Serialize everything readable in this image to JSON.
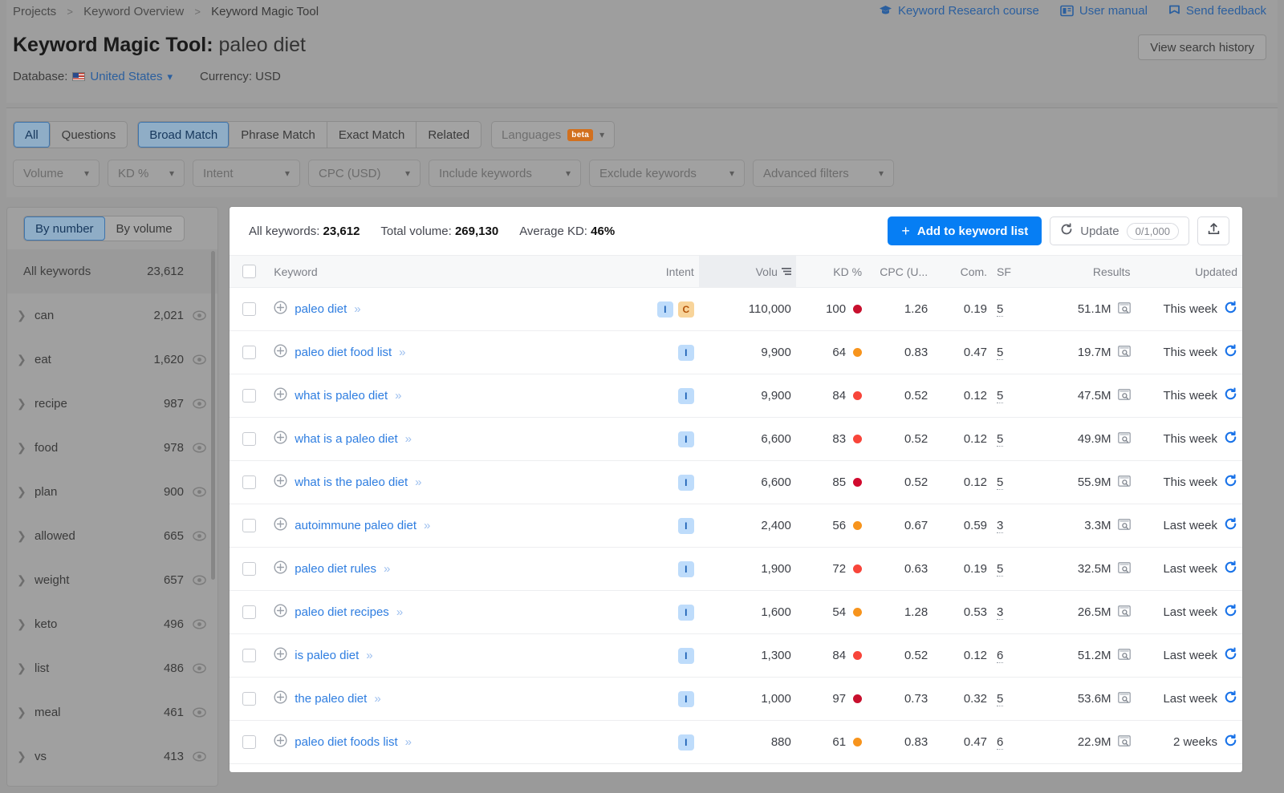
{
  "breadcrumb": {
    "items": [
      "Projects",
      "Keyword Overview",
      "Keyword Magic Tool"
    ],
    "separator": ">"
  },
  "header": {
    "title_prefix": "Keyword Magic Tool:",
    "query": "paleo diet",
    "view_search_history": "View search history",
    "links": [
      {
        "label": "Keyword Research course",
        "icon": "graduation-cap-icon"
      },
      {
        "label": "User manual",
        "icon": "book-icon"
      },
      {
        "label": "Send feedback",
        "icon": "flag-icon"
      }
    ],
    "database_label": "Database:",
    "database_value": "United States",
    "currency_label": "Currency: USD"
  },
  "filters": {
    "match_tabs_group1": [
      {
        "label": "All",
        "selected": true
      },
      {
        "label": "Questions",
        "selected": false
      }
    ],
    "match_tabs_group2": [
      {
        "label": "Broad Match",
        "selected": true
      },
      {
        "label": "Phrase Match",
        "selected": false
      },
      {
        "label": "Exact Match",
        "selected": false
      },
      {
        "label": "Related",
        "selected": false
      }
    ],
    "languages": {
      "label": "Languages",
      "badge": "beta"
    },
    "dropdowns": [
      "Volume",
      "KD %",
      "Intent",
      "CPC (USD)",
      "Include keywords",
      "Exclude keywords",
      "Advanced filters"
    ]
  },
  "sidebar": {
    "toggle": [
      {
        "label": "By number",
        "selected": true
      },
      {
        "label": "By volume",
        "selected": false
      }
    ],
    "all_keywords_label": "All keywords",
    "all_keywords_count": "23,612",
    "groups": [
      {
        "label": "can",
        "count": "2,021"
      },
      {
        "label": "eat",
        "count": "1,620"
      },
      {
        "label": "recipe",
        "count": "987"
      },
      {
        "label": "food",
        "count": "978"
      },
      {
        "label": "plan",
        "count": "900"
      },
      {
        "label": "allowed",
        "count": "665"
      },
      {
        "label": "weight",
        "count": "657"
      },
      {
        "label": "keto",
        "count": "496"
      },
      {
        "label": "list",
        "count": "486"
      },
      {
        "label": "meal",
        "count": "461"
      },
      {
        "label": "vs",
        "count": "413"
      }
    ]
  },
  "main": {
    "summary": {
      "all_keywords_label": "All keywords:",
      "all_keywords_value": "23,612",
      "total_volume_label": "Total volume:",
      "total_volume_value": "269,130",
      "average_kd_label": "Average KD:",
      "average_kd_value": "46%"
    },
    "actions": {
      "add_to_list": "Add to keyword list",
      "update": "Update",
      "update_count": "0/1,000",
      "export_icon": "upload-icon"
    },
    "columns": {
      "keyword": "Keyword",
      "intent": "Intent",
      "volume": "Volu",
      "kd": "KD %",
      "cpc": "CPC (U...",
      "com": "Com.",
      "sf": "SF",
      "results": "Results",
      "updated": "Updated"
    },
    "rows": [
      {
        "keyword": "paleo diet",
        "intents": [
          "I",
          "C"
        ],
        "volume": "110,000",
        "kd": "100",
        "kd_color": "#c8102e",
        "cpc": "1.26",
        "com": "0.19",
        "sf": "5",
        "results": "51.1M",
        "updated": "This week"
      },
      {
        "keyword": "paleo diet food list",
        "intents": [
          "I"
        ],
        "volume": "9,900",
        "kd": "64",
        "kd_color": "#f7941d",
        "cpc": "0.83",
        "com": "0.47",
        "sf": "5",
        "results": "19.7M",
        "updated": "This week"
      },
      {
        "keyword": "what is paleo diet",
        "intents": [
          "I"
        ],
        "volume": "9,900",
        "kd": "84",
        "kd_color": "#f8453a",
        "cpc": "0.52",
        "com": "0.12",
        "sf": "5",
        "results": "47.5M",
        "updated": "This week"
      },
      {
        "keyword": "what is a paleo diet",
        "intents": [
          "I"
        ],
        "volume": "6,600",
        "kd": "83",
        "kd_color": "#f8453a",
        "cpc": "0.52",
        "com": "0.12",
        "sf": "5",
        "results": "49.9M",
        "updated": "This week"
      },
      {
        "keyword": "what is the paleo diet",
        "intents": [
          "I"
        ],
        "volume": "6,600",
        "kd": "85",
        "kd_color": "#d10a2e",
        "cpc": "0.52",
        "com": "0.12",
        "sf": "5",
        "results": "55.9M",
        "updated": "This week"
      },
      {
        "keyword": "autoimmune paleo diet",
        "intents": [
          "I"
        ],
        "volume": "2,400",
        "kd": "56",
        "kd_color": "#f7941d",
        "cpc": "0.67",
        "com": "0.59",
        "sf": "3",
        "results": "3.3M",
        "updated": "Last week"
      },
      {
        "keyword": "paleo diet rules",
        "intents": [
          "I"
        ],
        "volume": "1,900",
        "kd": "72",
        "kd_color": "#f8453a",
        "cpc": "0.63",
        "com": "0.19",
        "sf": "5",
        "results": "32.5M",
        "updated": "Last week"
      },
      {
        "keyword": "paleo diet recipes",
        "intents": [
          "I"
        ],
        "volume": "1,600",
        "kd": "54",
        "kd_color": "#f7941d",
        "cpc": "1.28",
        "com": "0.53",
        "sf": "3",
        "results": "26.5M",
        "updated": "Last week"
      },
      {
        "keyword": "is paleo diet",
        "intents": [
          "I"
        ],
        "volume": "1,300",
        "kd": "84",
        "kd_color": "#f8453a",
        "cpc": "0.52",
        "com": "0.12",
        "sf": "6",
        "results": "51.2M",
        "updated": "Last week"
      },
      {
        "keyword": "the paleo diet",
        "intents": [
          "I"
        ],
        "volume": "1,000",
        "kd": "97",
        "kd_color": "#c8102e",
        "cpc": "0.73",
        "com": "0.32",
        "sf": "5",
        "results": "53.6M",
        "updated": "Last week"
      },
      {
        "keyword": "paleo diet foods list",
        "intents": [
          "I"
        ],
        "volume": "880",
        "kd": "61",
        "kd_color": "#f7941d",
        "cpc": "0.83",
        "com": "0.47",
        "sf": "6",
        "results": "22.9M",
        "updated": "2 weeks"
      }
    ]
  },
  "colors": {
    "accent": "#067ef4",
    "link": "#2e7de0",
    "selected_tab": "#8fadc6",
    "beta_badge": "#d2701e"
  }
}
